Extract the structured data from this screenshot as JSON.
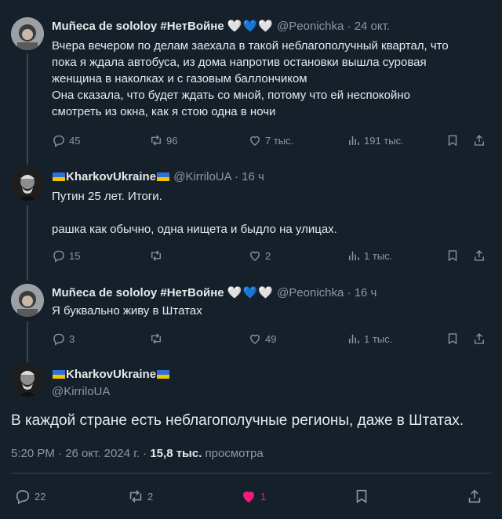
{
  "tweets": [
    {
      "name": "Muñeca de sololoy #НетВойне",
      "hearts": [
        "🤍",
        "💙",
        "🤍"
      ],
      "handle": "@Peonichka",
      "time": "24 окт.",
      "lines": [
        "Вчера вечером по делам заехала в такой неблагополучный квартал, что",
        "пока я ждала автобуса, из дома напротив остановки вышла суровая",
        "женщина в наколках и с газовым баллончиком",
        "Она сказала, что будет ждать со мной, потому что ей неспокойно",
        "смотреть из окна, как я стою одна в ночи"
      ],
      "replies": "45",
      "retweets": "96",
      "likes": "7 тыс.",
      "views": "191 тыс."
    },
    {
      "name": "KharkovUkraine",
      "handle": "@KirriloUA",
      "time": "16 ч",
      "lines": [
        "Путин 25 лет. Итоги.",
        "",
        "рашка как обычно, одна нищета и  быдло на улицах."
      ],
      "replies": "15",
      "retweets": "",
      "likes": "2",
      "views": "1 тыс."
    },
    {
      "name": "Muñeca de sololoy #НетВойне",
      "hearts": [
        "🤍",
        "💙",
        "🤍"
      ],
      "handle": "@Peonichka",
      "time": "16 ч",
      "lines": [
        "Я буквально живу в Штатах"
      ],
      "replies": "3",
      "retweets": "",
      "likes": "49",
      "views": "1 тыс."
    }
  ],
  "main": {
    "name": "KharkovUkraine",
    "handle": "@KirriloUA",
    "text": "В каждой стране есть неблагополучные регионы, даже в Штатах.",
    "timestamp": "5:20 PM · 26 окт. 2024 г. · ",
    "views_count": "15,8 тыс.",
    "views_label": " просмотра",
    "replies": "22",
    "retweets": "2",
    "likes": "1"
  },
  "colors": {
    "background": "#15202b",
    "muted": "#8b98a5",
    "like_active": "#f91880",
    "divider": "#38444d"
  }
}
